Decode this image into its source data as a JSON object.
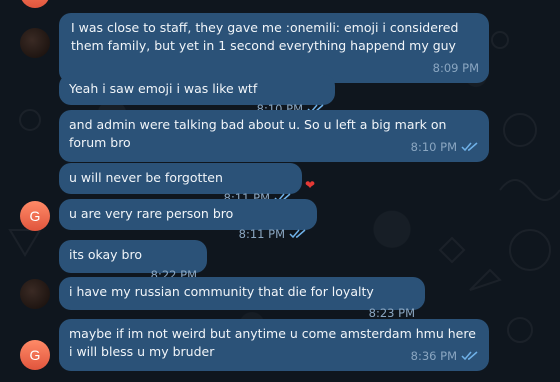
{
  "colors": {
    "bubble": "#2b5278",
    "meta_text": "#8aa6c1",
    "avatar_accent": "#e0553d"
  },
  "avatar_initial": "G",
  "messages": [
    {
      "text": "I was close to staff, they gave me :onemili: emoji i considered them family, but yet in 1 second everything happend my guy",
      "time": "8:09 PM",
      "read": false
    },
    {
      "text": "Yeah i saw emoji i was like wtf",
      "time": "8:10 PM",
      "read": true
    },
    {
      "text": "and admin were talking bad about u. So u left a big mark on forum bro",
      "time": "8:10 PM",
      "read": true
    },
    {
      "text": "u will never be forgotten",
      "time": "8:11 PM",
      "read": true,
      "reaction": "heart"
    },
    {
      "text": "u are very rare person bro",
      "time": "8:11 PM",
      "read": true
    },
    {
      "text": "its okay bro",
      "time": "8:22 PM",
      "read": false
    },
    {
      "text": "i have my russian community that die for loyalty",
      "time": "8:23 PM",
      "read": false
    },
    {
      "text": "maybe if im not weird but anytime u come amsterdam hmu here i will bless u my bruder",
      "time": "8:36 PM",
      "read": true
    }
  ]
}
